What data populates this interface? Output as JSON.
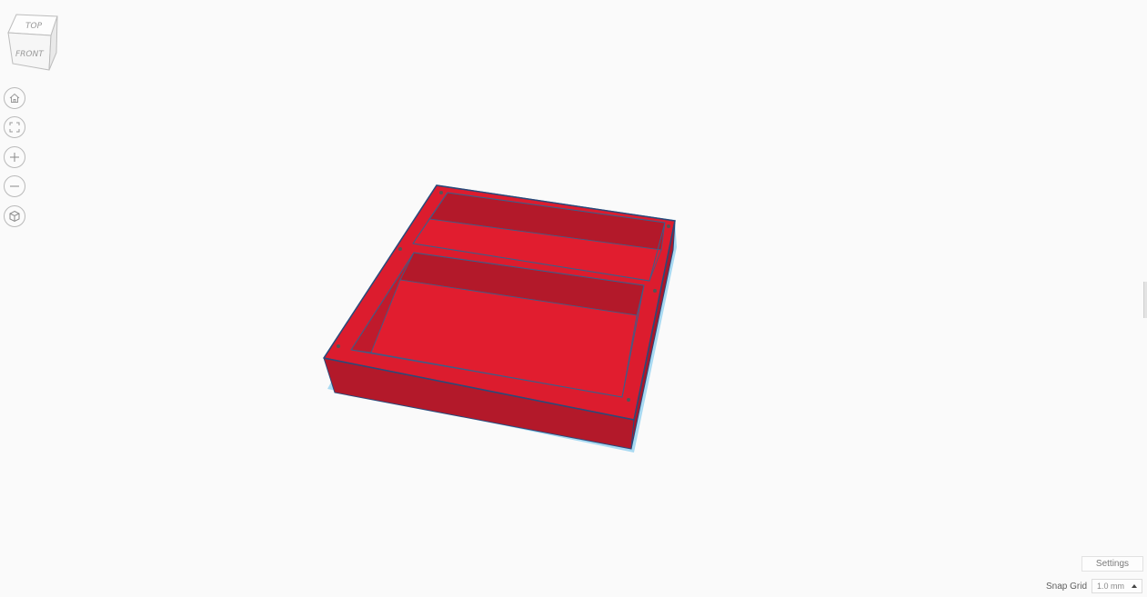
{
  "view_cube": {
    "top_label": "TOP",
    "front_label": "FRONT"
  },
  "nav_controls": [
    {
      "name": "home-view",
      "icon": "home-icon"
    },
    {
      "name": "fit-all",
      "icon": "fit-view-icon"
    },
    {
      "name": "zoom-in",
      "icon": "plus-icon"
    },
    {
      "name": "zoom-out",
      "icon": "minus-icon"
    },
    {
      "name": "perspective-toggle",
      "icon": "cube-projection-icon"
    }
  ],
  "model": {
    "color_main": "#dc1c2e",
    "color_side": "#b3192a",
    "color_floor": "#e11d2f",
    "selection_outline": "#3f8fd0",
    "shadow_color": "#a9daf2"
  },
  "footer": {
    "settings_label": "Settings",
    "snap_grid_label": "Snap Grid",
    "snap_grid_value": "1.0 mm"
  }
}
